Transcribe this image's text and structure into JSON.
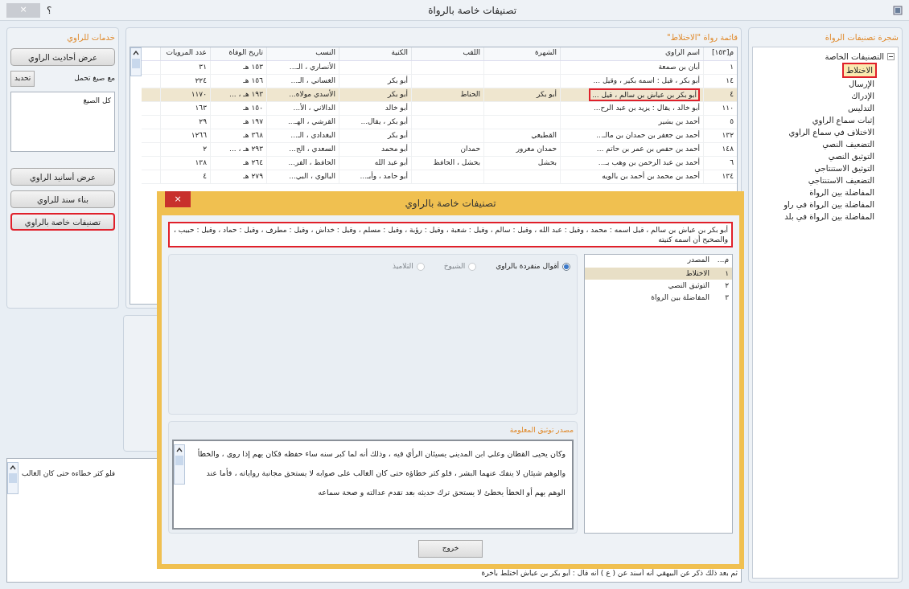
{
  "window": {
    "title": "تصنيفات خاصة بالرواة",
    "help": "؟",
    "close": "×"
  },
  "services": {
    "title": "خدمات للراوي",
    "buttons": [
      {
        "label": "عرض أحاديث الراوي",
        "highlighted": false
      }
    ],
    "filter_label": "مع صيغ تحمل",
    "filter_button": "تحديد",
    "list_items": [
      "كل الصيغ"
    ],
    "more_buttons": [
      {
        "label": "عرض أسانيد الراوي",
        "highlighted": false
      },
      {
        "label": "بناء سند للراوي",
        "highlighted": false
      },
      {
        "label": "تصنيفات خاصة بالراوي",
        "highlighted": true
      }
    ]
  },
  "table": {
    "title": "قائمة رواة \"الاختلاط\"",
    "columns": [
      "م[١٥٣]",
      "اسم الراوي",
      "الشهرة",
      "اللقب",
      "الكنية",
      "النسب",
      "تاريخ الوفاة",
      "عدد المرويات"
    ],
    "rows": [
      {
        "selected": false,
        "name_highlighted": false,
        "cells": [
          "١",
          "أبان بن صمعة",
          "",
          "",
          "",
          "الأنصاري ، الـ...",
          "١٥٣ هـ",
          "٣١"
        ]
      },
      {
        "selected": false,
        "name_highlighted": false,
        "cells": [
          "١٤",
          "أبو بكر ، قيل : اسمه بكير ، وقيل ...",
          "",
          "",
          "أبو بكر",
          "الغساني ، الـ...",
          "١٥٦ هـ",
          "٢٢٤"
        ]
      },
      {
        "selected": true,
        "name_highlighted": true,
        "cells": [
          "٤",
          "أبو بكر بن عياش بن سالم ، قيل ...",
          "أبو بكر",
          "الحناط",
          "أبو بكر",
          "الأسدي مولاه...",
          "١٩٣ هـ ، ...",
          "١١٧٠"
        ]
      },
      {
        "selected": false,
        "name_highlighted": false,
        "cells": [
          "١١٠",
          "أبو خالد ، يقال : يزيد بن عبد الرح...",
          "",
          "",
          "أبو خالد",
          "الدالاني ، الأ...",
          "١٥٠ هـ",
          "١٦٣"
        ]
      },
      {
        "selected": false,
        "name_highlighted": false,
        "cells": [
          "٥",
          "أحمد بن بشير",
          "",
          "",
          "أبو بكر ، يقال...",
          "القرشي ، الهـ...",
          "١٩٧ هـ",
          "٢٩"
        ]
      },
      {
        "selected": false,
        "name_highlighted": false,
        "cells": [
          "١٣٢",
          "أحمد بن جعفر بن حمدان بن مالـ...",
          "القطيعي",
          "",
          "أبو بكر",
          "البغدادي ، الـ...",
          "٣٦٨ هـ",
          "١٢٦٦"
        ]
      },
      {
        "selected": false,
        "name_highlighted": false,
        "cells": [
          "١٤٨",
          "أحمد بن حفص بن عمر بن حاتم ...",
          "حمدان مغرور",
          "حمدان",
          "أبو محمد",
          "السعدي ، الج...",
          "٢٩٣ هـ ، ...",
          "٢"
        ]
      },
      {
        "selected": false,
        "name_highlighted": false,
        "cells": [
          "٦",
          "أحمد بن عبد الرحمن بن وهب بـ...",
          "بحشل",
          "بحشل ، الحافظ",
          "أبو عبد الله",
          "الحافظ ، الفر...",
          "٢٦٤ هـ",
          "١٣٨"
        ]
      },
      {
        "selected": false,
        "name_highlighted": false,
        "cells": [
          "١٣٤",
          "أحمد بن محمد بن أحمد بن بالويه",
          "",
          "",
          "أبو حامد ، وأبـ...",
          "البالوي ، البي...",
          "٢٧٩ هـ",
          "٤"
        ]
      }
    ]
  },
  "tree": {
    "title": "شجرة تصنيفات الرواة",
    "root": {
      "label": "التصنيفات الخاصة",
      "expanded": true,
      "children": [
        {
          "label": "الاختلاط",
          "selected": true
        },
        {
          "label": "الإرسال",
          "selected": false
        },
        {
          "label": "الإدراك",
          "selected": false
        },
        {
          "label": "التدليس",
          "selected": false
        },
        {
          "label": "إثبات سماع الراوي",
          "selected": false
        },
        {
          "label": "الاختلاف في سماع الراوي",
          "selected": false
        },
        {
          "label": "التضعيف النصي",
          "selected": false
        },
        {
          "label": "التوثيق النصي",
          "selected": false
        },
        {
          "label": "التوثيق الاستنتاجي",
          "selected": false
        },
        {
          "label": "التضعيف الاستنتاجي",
          "selected": false
        },
        {
          "label": "المفاضلة بين الرواة",
          "selected": false
        },
        {
          "label": "المفاضلة بين الرواة في راو",
          "selected": false
        },
        {
          "label": "المفاضلة بين الرواة في بلد",
          "selected": false
        }
      ]
    }
  },
  "background_text": {
    "fragment": "فلو كثر خطاءه حتى كان الغالب",
    "last_line": "ثم بعد ذلك ذكر عن البيهقي أنه أسند عن ( ع ) أنه قال : أبو بكر بن عياش اختلط بأخرة"
  },
  "dialog": {
    "title": "تصنيفات خاصة بالراوي",
    "close": "×",
    "narrator": {
      "highlighted": true,
      "text": "أبو بكر بن عياش بن سالم ، قيل اسمه : محمد ، وقيل : عبد الله ، وقيل : سالم ، وقيل : شعبة ، وقيل : رؤبة ، وقيل : مسلم ، وقيل : خداش ، وقيل : مطرف ، وقيل : حماد ، وقيل : حبيب ، والصحيح أن اسمه كنيته"
    },
    "options": [
      {
        "label": "أقوال منفردة بالراوي",
        "selected": true,
        "disabled": false
      },
      {
        "label": "الشيوخ",
        "selected": false,
        "disabled": true
      },
      {
        "label": "التلاميذ",
        "selected": false,
        "disabled": true
      }
    ],
    "sources": {
      "columns": [
        "م...",
        "المصدر"
      ],
      "rows": [
        {
          "selected": true,
          "cells": [
            "١",
            "الاختلاط"
          ]
        },
        {
          "selected": false,
          "cells": [
            "٢",
            "التوثيق النصي"
          ]
        },
        {
          "selected": false,
          "cells": [
            "٣",
            "المفاضلة بين الرواة"
          ]
        }
      ]
    },
    "source_title": "مصدر توثيق المعلومة",
    "source_text": "وكان يحيى القطان وعلي ابن المديني يسيئان الرأي فيه ، وذلك أنه لما كبر سنه ساء حفظه فكان يهم إذا روى ، والخطأ والوهم شيئان لا ينفك عنهما البشر ، فلو كثر خطاؤه حتى كان الغالب على صوابه لا يستحق مجانبة رواياته ، فأما عند الوهم يهم أو الخطأ يخطئ لا يستحق ترك حديثه بعد تقدم عدالته و صحة سماعه",
    "exit": "خروج"
  }
}
